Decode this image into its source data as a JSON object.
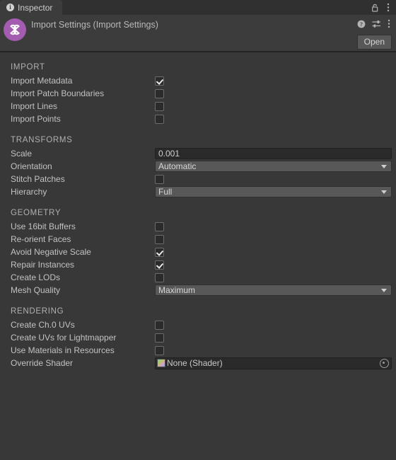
{
  "window": {
    "tab": {
      "label": "Inspector",
      "icon": "info-icon"
    },
    "lock_icon": "lock-icon",
    "menu_icon": "kebab-menu-icon"
  },
  "header": {
    "title": "Import Settings (Import Settings)",
    "icon": "import-settings-asset-icon",
    "help_icon": "help-icon",
    "preset_icon": "preset-settings-icon",
    "menu_icon": "kebab-menu-icon",
    "open_label": "Open"
  },
  "sections": [
    {
      "title": "IMPORT",
      "rows": [
        {
          "label": "Import Metadata",
          "type": "checkbox",
          "value": true
        },
        {
          "label": "Import Patch Boundaries",
          "type": "checkbox",
          "value": false
        },
        {
          "label": "Import Lines",
          "type": "checkbox",
          "value": false
        },
        {
          "label": "Import Points",
          "type": "checkbox",
          "value": false
        }
      ]
    },
    {
      "title": "TRANSFORMS",
      "rows": [
        {
          "label": "Scale",
          "type": "text",
          "value": "0.001"
        },
        {
          "label": "Orientation",
          "type": "dropdown",
          "value": "Automatic"
        },
        {
          "label": "Stitch Patches",
          "type": "checkbox",
          "value": false
        },
        {
          "label": "Hierarchy",
          "type": "dropdown",
          "value": "Full"
        }
      ]
    },
    {
      "title": "GEOMETRY",
      "rows": [
        {
          "label": "Use 16bit Buffers",
          "type": "checkbox",
          "value": false
        },
        {
          "label": "Re-orient Faces",
          "type": "checkbox",
          "value": false
        },
        {
          "label": "Avoid Negative Scale",
          "type": "checkbox",
          "value": true
        },
        {
          "label": "Repair Instances",
          "type": "checkbox",
          "value": true
        },
        {
          "label": "Create LODs",
          "type": "checkbox",
          "value": false
        },
        {
          "label": "Mesh Quality",
          "type": "dropdown",
          "value": "Maximum"
        }
      ]
    },
    {
      "title": "RENDERING",
      "rows": [
        {
          "label": "Create Ch.0 UVs",
          "type": "checkbox",
          "value": false
        },
        {
          "label": "Create UVs for Lightmapper",
          "type": "checkbox",
          "value": false
        },
        {
          "label": "Use Materials in Resources",
          "type": "checkbox",
          "value": false
        },
        {
          "label": "Override Shader",
          "type": "object",
          "value": "None (Shader)"
        }
      ]
    }
  ],
  "colors": {
    "window_bg": "#383838",
    "header_bg": "#3c3c3c",
    "tabbar_bg": "#303030",
    "accent_icon": "#a35cb0",
    "dropdown_bg": "#585858",
    "input_bg": "#2a2a2a"
  }
}
